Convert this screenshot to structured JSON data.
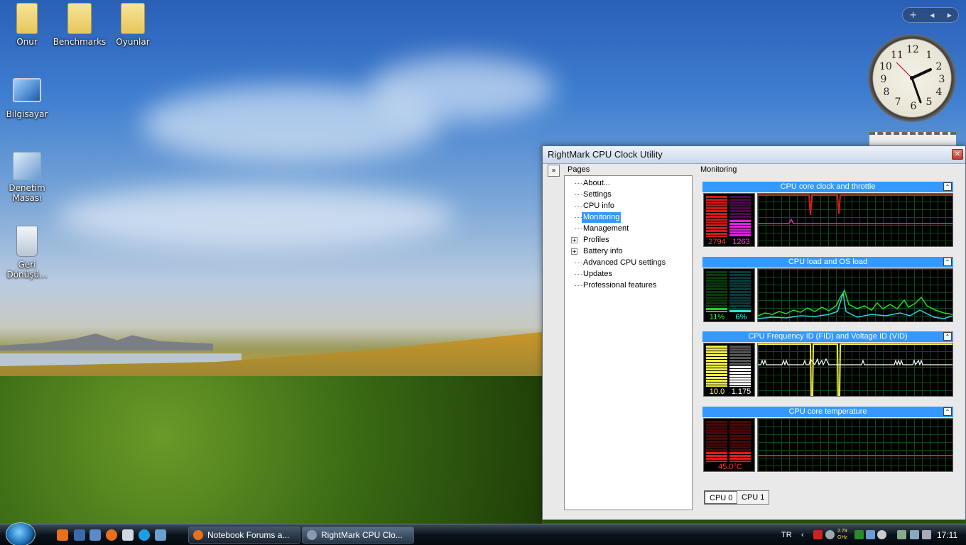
{
  "desktop": {
    "icons": [
      {
        "label": "Onur"
      },
      {
        "label": "Benchmarks"
      },
      {
        "label": "Oyunlar"
      },
      {
        "label": "Bilgisayar"
      },
      {
        "label": "Denetim Masası"
      },
      {
        "label": "Geri Dönüşü..."
      }
    ]
  },
  "gadgets": {
    "bar_plus": "+",
    "bar_prev": "◀",
    "bar_next": "▶",
    "clock_numbers": [
      "12",
      "1",
      "2",
      "3",
      "4",
      "5",
      "6",
      "7",
      "8",
      "9",
      "10",
      "11"
    ]
  },
  "window": {
    "title": "RightMark CPU Clock Utility",
    "close": "✕",
    "collapse": "»",
    "pages_label": "Pages",
    "monitoring_label": "Monitoring",
    "tree": [
      {
        "label": "About..."
      },
      {
        "label": "Settings"
      },
      {
        "label": "CPU info"
      },
      {
        "label": "Monitoring",
        "selected": true
      },
      {
        "label": "Management"
      },
      {
        "label": "Profiles",
        "expandable": true
      },
      {
        "label": "Battery info",
        "expandable": true
      },
      {
        "label": "Advanced CPU settings"
      },
      {
        "label": "Updates"
      },
      {
        "label": "Professional features"
      }
    ],
    "panels": [
      {
        "title": "CPU core clock and throttle",
        "v1": "2794",
        "v2": "1263"
      },
      {
        "title": "CPU load and OS load",
        "v1": "11%",
        "v2": "6%"
      },
      {
        "title": "CPU Frequency ID (FID) and Voltage ID (VID)",
        "v1": "10.0",
        "v2": "1.175"
      },
      {
        "title": "CPU core temperature",
        "v1": "45.0°C"
      }
    ],
    "cpu_tabs": [
      "CPU 0",
      "CPU 1"
    ]
  },
  "taskbar": {
    "tasks": [
      {
        "label": "Notebook Forums a..."
      },
      {
        "label": "RightMark CPU Clo..."
      }
    ],
    "language": "TR",
    "cpu_speed": "2.79 GHz",
    "time": "17:11"
  }
}
